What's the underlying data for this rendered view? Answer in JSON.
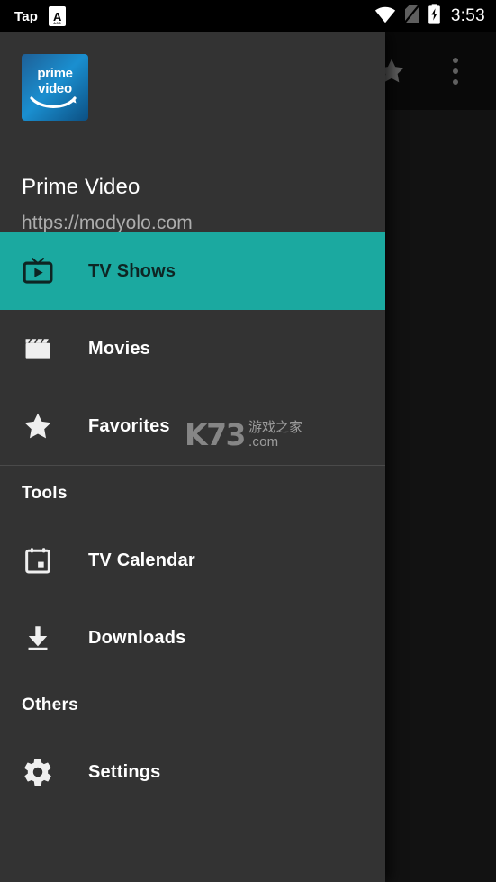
{
  "status_bar": {
    "left_text": "Tap",
    "app_badge_letter": "A",
    "app_badge_sub": "AOS",
    "wifi_icon": "wifi-icon",
    "no_sim_icon": "no-sim-icon",
    "battery_icon": "battery-charging-icon",
    "time": "3:53"
  },
  "app_bar": {
    "star_icon": "star-icon",
    "overflow_icon": "overflow-menu-icon"
  },
  "drawer": {
    "brand": {
      "logo_line1": "prime",
      "logo_line2": "video",
      "logo_alt": "prime-video-logo",
      "title": "Prime Video",
      "url": "https://modyolo.com"
    },
    "primary_items": [
      {
        "label": "TV Shows",
        "icon": "tv-icon",
        "selected": true
      },
      {
        "label": "Movies",
        "icon": "clapperboard-icon",
        "selected": false
      },
      {
        "label": "Favorites",
        "icon": "star-icon",
        "selected": false
      }
    ],
    "sections": [
      {
        "header": "Tools",
        "items": [
          {
            "label": "TV Calendar",
            "icon": "calendar-icon",
            "selected": false
          },
          {
            "label": "Downloads",
            "icon": "download-icon",
            "selected": false
          }
        ]
      },
      {
        "header": "Others",
        "items": [
          {
            "label": "Settings",
            "icon": "gear-icon",
            "selected": false
          }
        ]
      }
    ]
  },
  "watermark": {
    "logo": "K73",
    "cn_text": "游戏之家",
    "domain": ".com"
  },
  "colors": {
    "accent": "#1ba9a0",
    "drawer_bg": "#333333",
    "app_bar_bg": "#0d0d0d",
    "content_bg": "#1a1a1a",
    "status_bar_bg": "#000000",
    "brand_blue": "#1a8fd0"
  }
}
